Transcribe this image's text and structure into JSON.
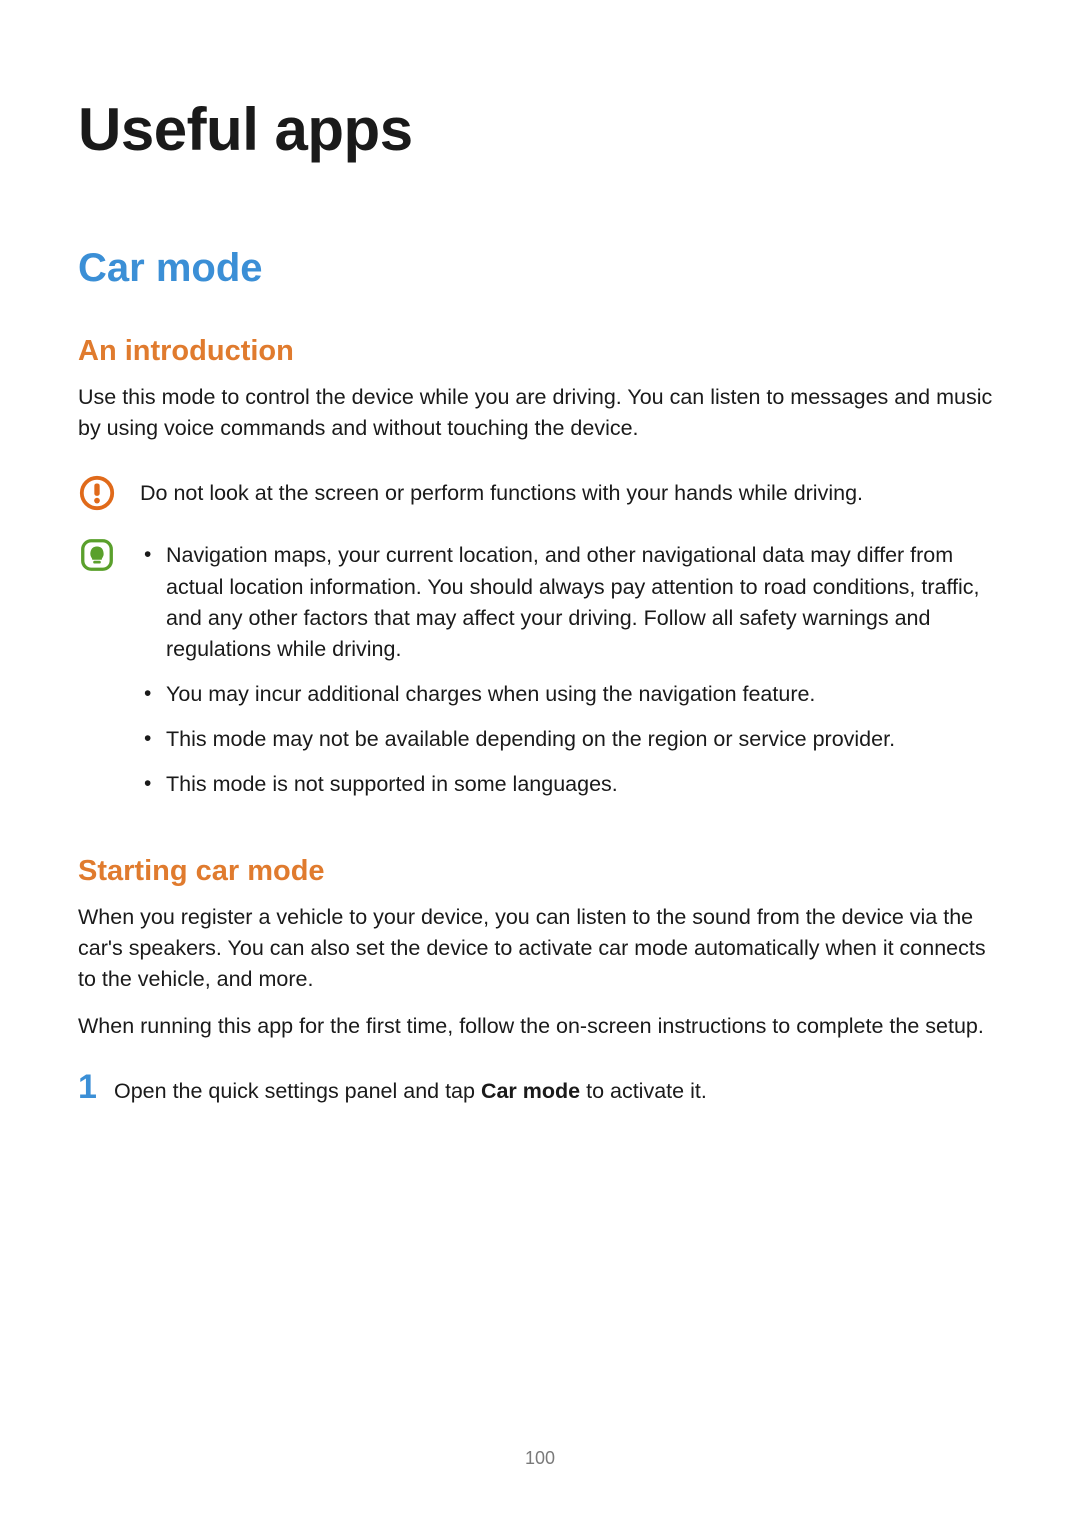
{
  "page": {
    "title": "Useful apps",
    "section_title": "Car mode",
    "intro_heading": "An introduction",
    "intro_body": "Use this mode to control the device while you are driving. You can listen to messages and music by using voice commands and without touching the device.",
    "warning_text": "Do not look at the screen or perform functions with your hands while driving.",
    "notes": [
      "Navigation maps, your current location, and other navigational data may differ from actual location information. You should always pay attention to road conditions, traffic, and any other factors that may affect your driving. Follow all safety warnings and regulations while driving.",
      "You may incur additional charges when using the navigation feature.",
      "This mode may not be available depending on the region or service provider.",
      "This mode is not supported in some languages."
    ],
    "start_heading": "Starting car mode",
    "start_body_1": "When you register a vehicle to your device, you can listen to the sound from the device via the car's speakers. You can also set the device to activate car mode automatically when it connects to the vehicle, and more.",
    "start_body_2": "When running this app for the first time, follow the on-screen instructions to complete the setup.",
    "step_number": "1",
    "step_prefix": "Open the quick settings panel and tap ",
    "step_bold": "Car mode",
    "step_suffix": " to activate it.",
    "page_number": "100"
  },
  "icons": {
    "warning": "warning-icon",
    "note": "note-icon"
  }
}
